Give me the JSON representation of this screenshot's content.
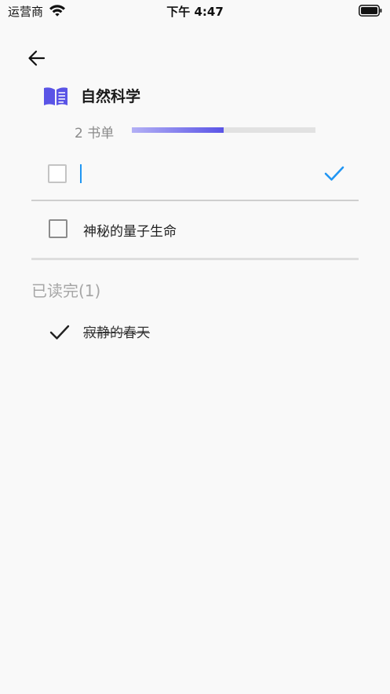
{
  "status_bar": {
    "carrier": "运营商",
    "time": "下午 4:47"
  },
  "header": {
    "icon": "open-book-icon",
    "title": "自然科学",
    "count_label": "2 书单",
    "progress": 0.5,
    "accent_color": "#5a54e6"
  },
  "new_item": {
    "value": "",
    "confirm_icon": "checkmark-icon",
    "confirm_color": "#2196f3"
  },
  "todo_items": [
    {
      "label": "神秘的量子生命",
      "checked": false
    }
  ],
  "done_section": {
    "title": "已读完(1)",
    "items": [
      {
        "label": "寂静的春天",
        "checked": true
      }
    ]
  }
}
